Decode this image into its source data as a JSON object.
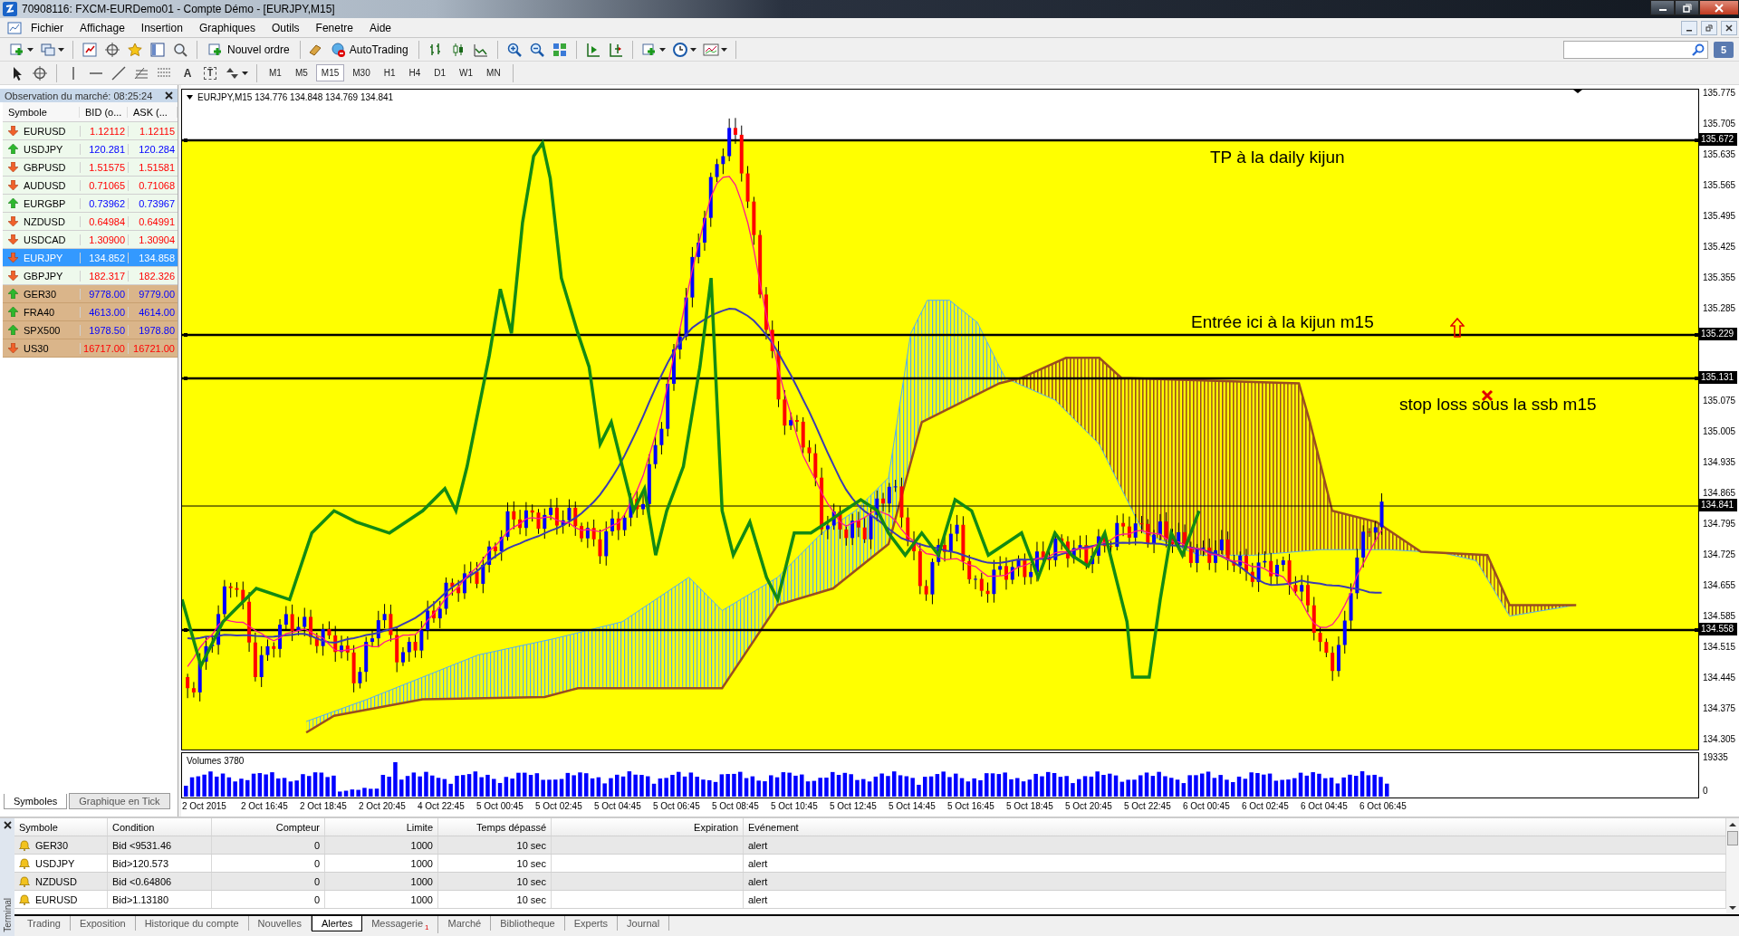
{
  "window": {
    "title": "70908116: FXCM-EURDemo01 - Compte Démo - [EURJPY,M15]"
  },
  "menu": [
    "Fichier",
    "Affichage",
    "Insertion",
    "Graphiques",
    "Outils",
    "Fenetre",
    "Aide"
  ],
  "toolbar": {
    "new_order": "Nouvel ordre",
    "autotrading": "AutoTrading",
    "notifications": "5"
  },
  "drawing_tools": {
    "text_tool": "A",
    "label_tool": "T"
  },
  "timeframes": [
    {
      "label": "M1",
      "selected": false
    },
    {
      "label": "M5",
      "selected": false
    },
    {
      "label": "M15",
      "selected": true
    },
    {
      "label": "M30",
      "selected": false
    },
    {
      "label": "H1",
      "selected": false
    },
    {
      "label": "H4",
      "selected": false
    },
    {
      "label": "D1",
      "selected": false
    },
    {
      "label": "W1",
      "selected": false
    },
    {
      "label": "MN",
      "selected": false
    }
  ],
  "market_watch": {
    "title": "Observation du marché: 08:25:24",
    "columns": [
      "Symbole",
      "BID (o...",
      "ASK (..."
    ],
    "rows": [
      {
        "symbol": "EURUSD",
        "bid": "1.12112",
        "ask": "1.12115",
        "rising": false,
        "kind": "forex",
        "selected": false
      },
      {
        "symbol": "USDJPY",
        "bid": "120.281",
        "ask": "120.284",
        "rising": true,
        "kind": "forex",
        "selected": false
      },
      {
        "symbol": "GBPUSD",
        "bid": "1.51575",
        "ask": "1.51581",
        "rising": false,
        "kind": "forex",
        "selected": false
      },
      {
        "symbol": "AUDUSD",
        "bid": "0.71065",
        "ask": "0.71068",
        "rising": false,
        "kind": "forex",
        "selected": false
      },
      {
        "symbol": "EURGBP",
        "bid": "0.73962",
        "ask": "0.73967",
        "rising": true,
        "kind": "forex",
        "selected": false
      },
      {
        "symbol": "NZDUSD",
        "bid": "0.64984",
        "ask": "0.64991",
        "rising": false,
        "kind": "forex",
        "selected": false
      },
      {
        "symbol": "USDCAD",
        "bid": "1.30900",
        "ask": "1.30904",
        "rising": false,
        "kind": "forex",
        "selected": false
      },
      {
        "symbol": "EURJPY",
        "bid": "134.852",
        "ask": "134.858",
        "rising": false,
        "kind": "forex",
        "selected": true
      },
      {
        "symbol": "GBPJPY",
        "bid": "182.317",
        "ask": "182.326",
        "rising": false,
        "kind": "forex",
        "selected": false
      },
      {
        "symbol": "GER30",
        "bid": "9778.00",
        "ask": "9779.00",
        "rising": true,
        "kind": "index",
        "selected": false
      },
      {
        "symbol": "FRA40",
        "bid": "4613.00",
        "ask": "4614.00",
        "rising": true,
        "kind": "index",
        "selected": false
      },
      {
        "symbol": "SPX500",
        "bid": "1978.50",
        "ask": "1978.80",
        "rising": true,
        "kind": "index",
        "selected": false
      },
      {
        "symbol": "US30",
        "bid": "16717.00",
        "ask": "16721.00",
        "rising": false,
        "kind": "index",
        "selected": false
      }
    ],
    "tabs": [
      {
        "label": "Symboles",
        "selected": true
      },
      {
        "label": "Graphique en Tick",
        "selected": false
      }
    ]
  },
  "chart": {
    "header": "EURJPY,M15 134.776 134.848 134.769 134.841",
    "annotations": [
      {
        "text": "TP à la daily kijun"
      },
      {
        "text": "Entrée ici à la kijun m15"
      },
      {
        "text": "stop loss sous la ssb m15"
      }
    ],
    "price_lines": [
      {
        "label": "135.672",
        "kind": "level"
      },
      {
        "label": "135.229",
        "kind": "level"
      },
      {
        "label": "135.131",
        "kind": "level"
      },
      {
        "label": "134.841",
        "kind": "bid"
      },
      {
        "label": "134.558",
        "kind": "level"
      }
    ],
    "price_axis": [
      "135.775",
      "135.705",
      "135.635",
      "135.565",
      "135.495",
      "135.425",
      "135.355",
      "135.285",
      "135.075",
      "135.005",
      "134.935",
      "134.865",
      "134.795",
      "134.725",
      "134.655",
      "134.585",
      "134.515",
      "134.445",
      "134.375",
      "134.305"
    ],
    "volume_label": "Volumes 3780",
    "volume_axis": [
      "19335",
      "0"
    ],
    "time_axis": [
      "2 Oct 2015",
      "2 Oct 16:45",
      "2 Oct 18:45",
      "2 Oct 20:45",
      "4 Oct 22:45",
      "5 Oct 00:45",
      "5 Oct 02:45",
      "5 Oct 04:45",
      "5 Oct 06:45",
      "5 Oct 08:45",
      "5 Oct 10:45",
      "5 Oct 12:45",
      "5 Oct 14:45",
      "5 Oct 16:45",
      "5 Oct 18:45",
      "5 Oct 20:45",
      "5 Oct 22:45",
      "6 Oct 00:45",
      "6 Oct 02:45",
      "6 Oct 04:45",
      "6 Oct 06:45"
    ]
  },
  "terminal": {
    "side_label": "Terminal",
    "columns": [
      "Symbole",
      "Condition",
      "Compteur",
      "Limite",
      "Temps dépassé",
      "Expiration",
      "Evénement"
    ],
    "rows": [
      {
        "symbol": "GER30",
        "condition": "Bid <9531.46",
        "counter": "0",
        "limit": "1000",
        "timeout": "10 sec",
        "event": "alert"
      },
      {
        "symbol": "USDJPY",
        "condition": "Bid>120.573",
        "counter": "0",
        "limit": "1000",
        "timeout": "10 sec",
        "event": "alert"
      },
      {
        "symbol": "NZDUSD",
        "condition": "Bid <0.64806",
        "counter": "0",
        "limit": "1000",
        "timeout": "10 sec",
        "event": "alert"
      },
      {
        "symbol": "EURUSD",
        "condition": "Bid>1.13180",
        "counter": "0",
        "limit": "1000",
        "timeout": "10 sec",
        "event": "alert"
      }
    ],
    "tabs": [
      {
        "label": "Trading",
        "selected": false
      },
      {
        "label": "Exposition",
        "selected": false
      },
      {
        "label": "Historique du compte",
        "selected": false
      },
      {
        "label": "Nouvelles",
        "selected": false
      },
      {
        "label": "Alertes",
        "selected": true
      },
      {
        "label": "Messagerie",
        "selected": false,
        "badge": "1"
      },
      {
        "label": "Marché",
        "selected": false
      },
      {
        "label": "Bibliotheque",
        "selected": false
      },
      {
        "label": "Experts",
        "selected": false
      },
      {
        "label": "Journal",
        "selected": false
      }
    ]
  }
}
